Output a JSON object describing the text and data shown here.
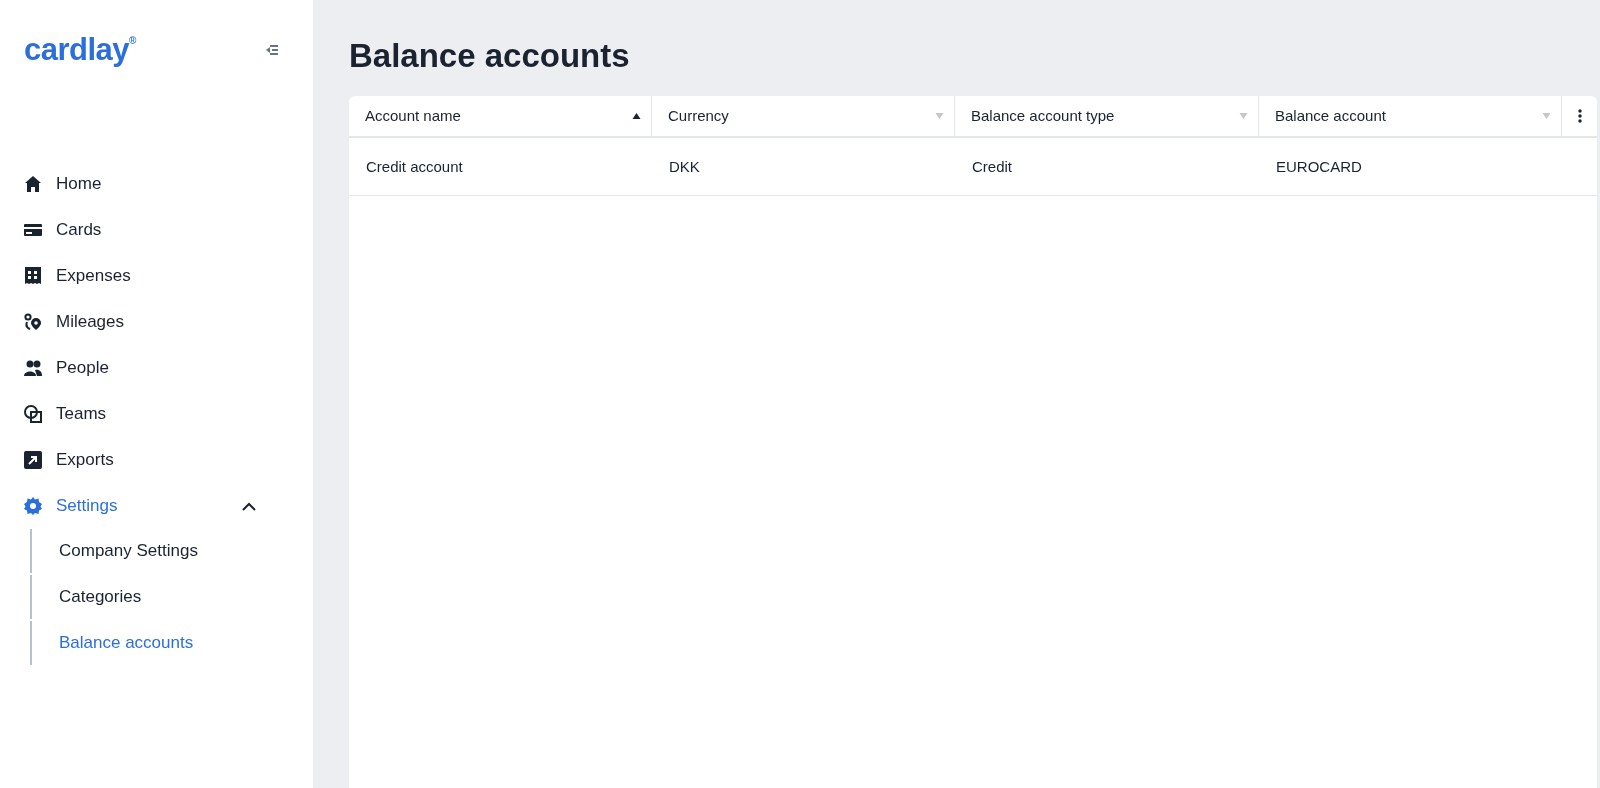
{
  "sidebar": {
    "logo": "cardlay",
    "logo_mark": "®",
    "items": [
      {
        "label": "Home",
        "kind": "home",
        "selected": false
      },
      {
        "label": "Cards",
        "kind": "card",
        "selected": false
      },
      {
        "label": "Expenses",
        "kind": "receipt",
        "selected": false
      },
      {
        "label": "Mileages",
        "kind": "pins",
        "selected": false
      },
      {
        "label": "People",
        "kind": "people",
        "selected": false
      },
      {
        "label": "Teams",
        "kind": "teams",
        "selected": false
      },
      {
        "label": "Exports",
        "kind": "export",
        "selected": false
      },
      {
        "label": "Settings",
        "kind": "gear",
        "selected": true,
        "expanded": true,
        "children": [
          {
            "label": "Company Settings",
            "selected": false
          },
          {
            "label": "Categories",
            "selected": false
          },
          {
            "label": "Balance accounts",
            "selected": true
          }
        ]
      }
    ]
  },
  "page": {
    "title": "Balance accounts"
  },
  "table": {
    "columns": [
      {
        "label": "Account name",
        "sorted": true
      },
      {
        "label": "Currency",
        "sorted": false
      },
      {
        "label": "Balance account type",
        "sorted": false
      },
      {
        "label": "Balance account",
        "sorted": false
      }
    ],
    "rows": [
      [
        "Credit account",
        "DKK",
        "Credit",
        "EUROCARD"
      ]
    ]
  }
}
